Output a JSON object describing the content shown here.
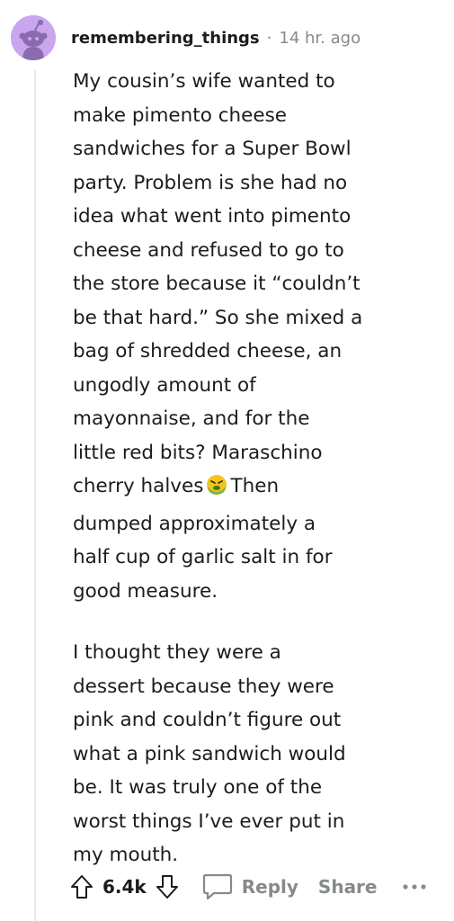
{
  "comment": {
    "username": "remembering_things",
    "separator": "·",
    "timestamp": "14 hr. ago",
    "paragraph1_before_emoji": "My cousin’s wife wanted to\nmake pimento cheese\nsandwiches for a Super Bowl\nparty. Problem is she had no\nidea what went into pimento\ncheese and refused to go to\nthe store because it “couldn’t\nbe that hard.” So she mixed a\nbag of shredded cheese, an\nungodly amount of\nmayonnaise, and for the\nlittle red bits? Maraschino\ncherry halves",
    "emoji_name": "nauseated-face-icon",
    "paragraph1_after_emoji": "Then\ndumped approximately a\nhalf cup of garlic salt in for\ngood measure.",
    "paragraph2": "I thought they were a\ndessert because they were\npink and couldn’t figure out\nwhat a pink sandwich would\nbe. It was truly one of the\nworst things I’ve ever put in\nmy mouth."
  },
  "actions": {
    "score": "6.4k",
    "reply_label": "Reply",
    "share_label": "Share",
    "upvote_icon": "upvote-icon",
    "downvote_icon": "downvote-icon",
    "reply_icon": "comment-bubble-icon",
    "more_icon": "more-options-icon"
  },
  "colors": {
    "avatar_bg": "#c9a6ee",
    "avatar_figure": "#8a6bad",
    "text": "#1c1c1c",
    "muted": "#878a8c"
  }
}
